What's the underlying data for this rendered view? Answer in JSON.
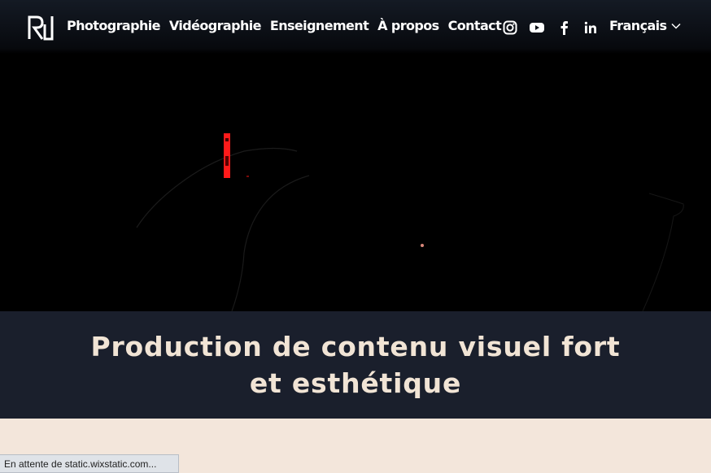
{
  "header": {
    "logo_icon": "rd-monogram-icon",
    "nav": [
      {
        "label": "Photographie"
      },
      {
        "label": "Vidéographie"
      },
      {
        "label": "Enseignement"
      },
      {
        "label": "À propos"
      },
      {
        "label": "Contact"
      }
    ],
    "social_icons": [
      "instagram-icon",
      "youtube-icon",
      "facebook-icon",
      "linkedin-icon"
    ],
    "language": {
      "label": "Français",
      "icon": "chevron-down-icon"
    }
  },
  "banner": {
    "title_line1": "Production de contenu visuel fort",
    "title_line2": "et esthétique"
  },
  "status_bar": {
    "text": "En attente de static.wixstatic.com..."
  },
  "colors": {
    "header_bg": "#0b0f16",
    "banner_bg": "#1a1f2c",
    "headline": "#f1e4d5",
    "cream": "#f3e6db",
    "hero_bg": "#000000",
    "hero_red_light": "#ff1a1a"
  }
}
